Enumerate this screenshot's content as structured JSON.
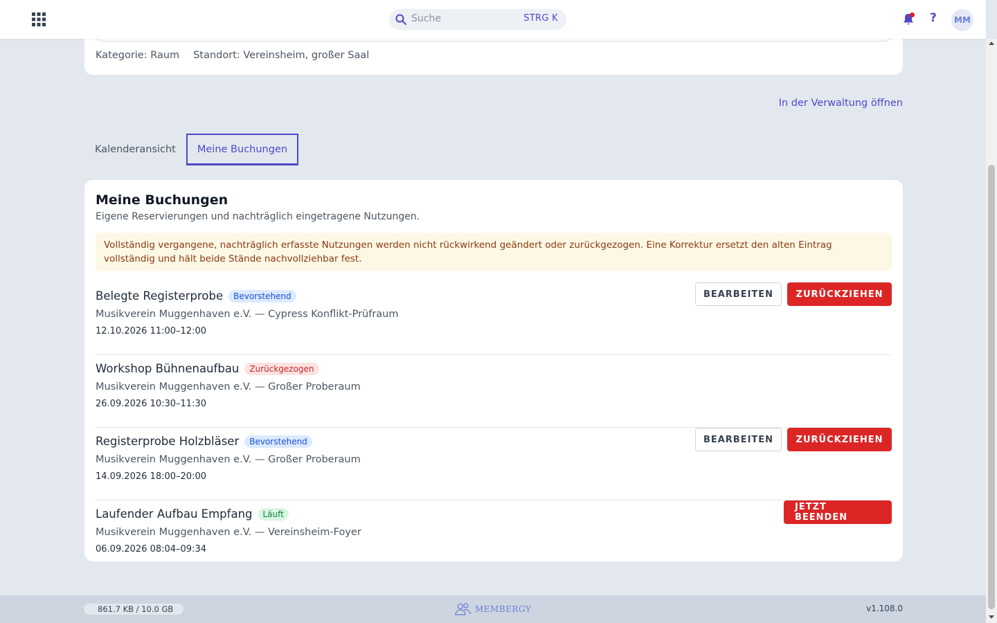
{
  "header": {
    "search_placeholder": "Suche",
    "search_shortcut": "STRG K",
    "help_label": "?",
    "avatar_initials": "MM"
  },
  "resource": {
    "category": "Kategorie: Raum",
    "location": "Standort: Vereinsheim, großer Saal"
  },
  "admin_link": "In der Verwaltung öffnen",
  "tabs": [
    {
      "label": "Kalenderansicht",
      "active": false
    },
    {
      "label": "Meine Buchungen",
      "active": true
    }
  ],
  "section": {
    "title": "Meine Buchungen",
    "subtitle": "Eigene Reservierungen und nachträglich eingetragene Nutzungen.",
    "notice": "Vollständig vergangene, nachträglich erfasste Nutzungen werden nicht rückwirkend geändert oder zurückgezogen. Eine Korrektur ersetzt den alten Eintrag vollständig und hält beide Stände nachvollziehbar fest."
  },
  "bookings": [
    {
      "title": "Belegte Registerprobe",
      "status": "Bevorstehend",
      "place": "Musikverein Muggenhaven e.V. — Cypress Konflikt-Prüfraum",
      "time": "12.10.2026 11:00–12:00",
      "edit_label": "BEARBEITEN",
      "withdraw_label": "ZURÜCKZIEHEN"
    },
    {
      "title": "Workshop Bühnenaufbau",
      "status": "Zurückgezogen",
      "place": "Musikverein Muggenhaven e.V. — Großer Proberaum",
      "time": "26.09.2026 10:30–11:30"
    },
    {
      "title": "Registerprobe Holzbläser",
      "status": "Bevorstehend",
      "place": "Musikverein Muggenhaven e.V. — Großer Proberaum",
      "time": "14.09.2026 18:00–20:00",
      "edit_label": "BEARBEITEN",
      "withdraw_label": "ZURÜCKZIEHEN"
    },
    {
      "title": "Laufender Aufbau Empfang",
      "status": "Läuft",
      "place": "Musikverein Muggenhaven e.V. — Vereinsheim-Foyer",
      "time": "06.09.2026 08:04–09:34",
      "end_label": "JETZT BEENDEN"
    }
  ],
  "footer": {
    "storage": "861.7 KB / 10.0 GB",
    "logo_text": "MEMBERGY",
    "version": "v1.108.0"
  },
  "colors": {
    "accent": "#4f46c8",
    "danger": "#dc2626",
    "background": "#e3e8ef"
  }
}
